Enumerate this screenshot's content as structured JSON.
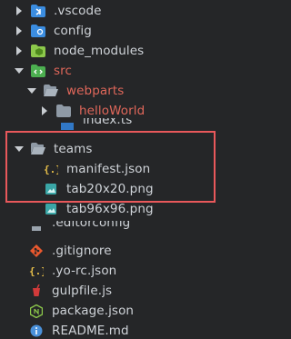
{
  "tree": {
    "vscode": ".vscode",
    "config": "config",
    "node_modules": "node_modules",
    "src": "src",
    "webparts": "webparts",
    "helloWorld": "helloWorld",
    "index_ts": "index.ts",
    "teams": "teams",
    "manifest": "manifest.json",
    "tab20": "tab20x20.png",
    "tab96": "tab96x96.png",
    "editorconfig": ".editorconfig",
    "gitignore": ".gitignore",
    "yo_rc": ".yo-rc.json",
    "gulpfile": "gulpfile.js",
    "package_json": "package.json",
    "readme": "README.md"
  },
  "icons": {
    "vscode": "vscode-folder-icon",
    "config": "folder-icon",
    "node_modules": "node-modules-folder-icon",
    "src": "src-folder-icon",
    "webparts": "folder-open-icon",
    "helloWorld": "folder-icon",
    "index_ts": "typescript-file-icon",
    "teams": "folder-open-icon",
    "manifest": "json-file-icon",
    "tab20": "image-file-icon",
    "tab96": "image-file-icon",
    "editorconfig": "editorconfig-file-icon",
    "gitignore": "git-icon",
    "yo_rc": "json-file-icon",
    "gulpfile": "gulp-icon",
    "package_json": "nodejs-icon",
    "readme": "info-icon"
  },
  "colors": {
    "background": "#252628",
    "text": "#cfd3d8",
    "text_highlight": "#e0675a",
    "highlight_border": "#e9585b",
    "folder": "#8f9aa6",
    "vscode_blue": "#3b8de0",
    "image_teal": "#3aa6a6",
    "json_yellow": "#e8c04a",
    "git_orange": "#e9582e",
    "gulp_red": "#d23a3a",
    "node_green": "#8cc84b",
    "readme_blue": "#4a90d9"
  }
}
